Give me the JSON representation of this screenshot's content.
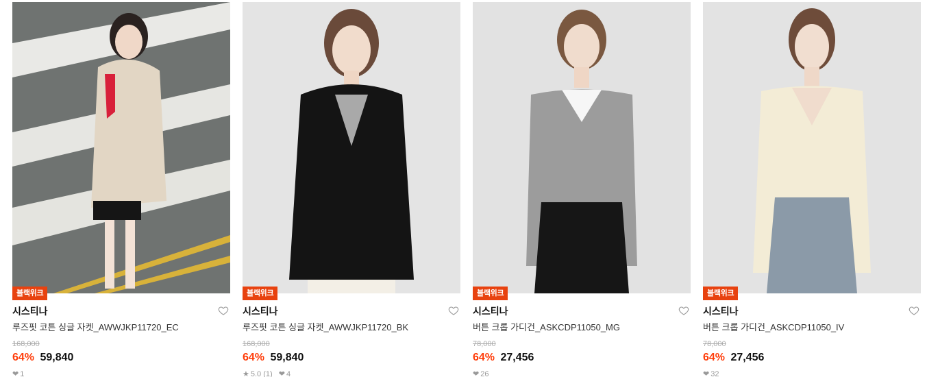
{
  "products": [
    {
      "badge": "블랙위크",
      "brand": "시스티나",
      "name": "루즈핏 코튼 싱글 자켓_AWWJKP11720_EC",
      "original_price": "168,000",
      "discount": "64%",
      "sale_price": "59,840",
      "rating": "",
      "review_count": "",
      "like_count": "1",
      "image_icon": "product-photo-beige-jacket"
    },
    {
      "badge": "블랙위크",
      "brand": "시스티나",
      "name": "루즈핏 코튼 싱글 자켓_AWWJKP11720_BK",
      "original_price": "168,000",
      "discount": "64%",
      "sale_price": "59,840",
      "rating": "5.0",
      "review_count": "(1)",
      "like_count": "4",
      "image_icon": "product-photo-black-jacket"
    },
    {
      "badge": "블랙위크",
      "brand": "시스티나",
      "name": "버튼 크롭 가디건_ASKCDP11050_MG",
      "original_price": "78,000",
      "discount": "64%",
      "sale_price": "27,456",
      "rating": "",
      "review_count": "",
      "like_count": "26",
      "image_icon": "product-photo-grey-cardigan"
    },
    {
      "badge": "블랙위크",
      "brand": "시스티나",
      "name": "버튼 크롭 가디건_ASKCDP11050_IV",
      "original_price": "78,000",
      "discount": "64%",
      "sale_price": "27,456",
      "rating": "",
      "review_count": "",
      "like_count": "32",
      "image_icon": "product-photo-ivory-cardigan"
    }
  ],
  "colors": {
    "badge_bg": "#e8420f",
    "discount": "#ff3d0a",
    "original_price": "#aaaaaa"
  }
}
